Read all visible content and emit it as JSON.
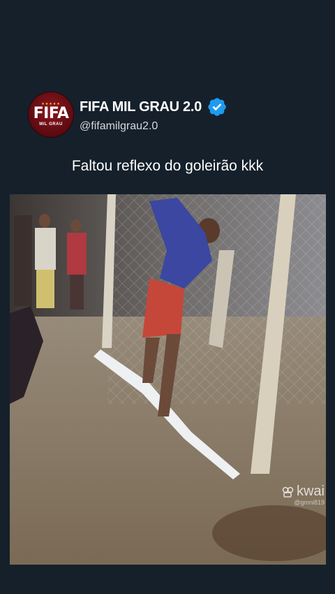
{
  "post": {
    "avatar": {
      "logo_text": "FIFA",
      "logo_subtext": "MIL GRAU",
      "stars": "★★★★★"
    },
    "display_name": "FIFA MIL GRAU 2.0",
    "handle": "@fifamilgrau2.0",
    "verified_icon": "verified-badge-icon",
    "caption": "Faltou reflexo do goleirão kkk"
  },
  "media": {
    "watermark_brand": "kwai",
    "watermark_user": "@gmni819"
  },
  "colors": {
    "background": "#15202b",
    "verified": "#1d9bf0",
    "avatar_red": "#8e1620"
  }
}
